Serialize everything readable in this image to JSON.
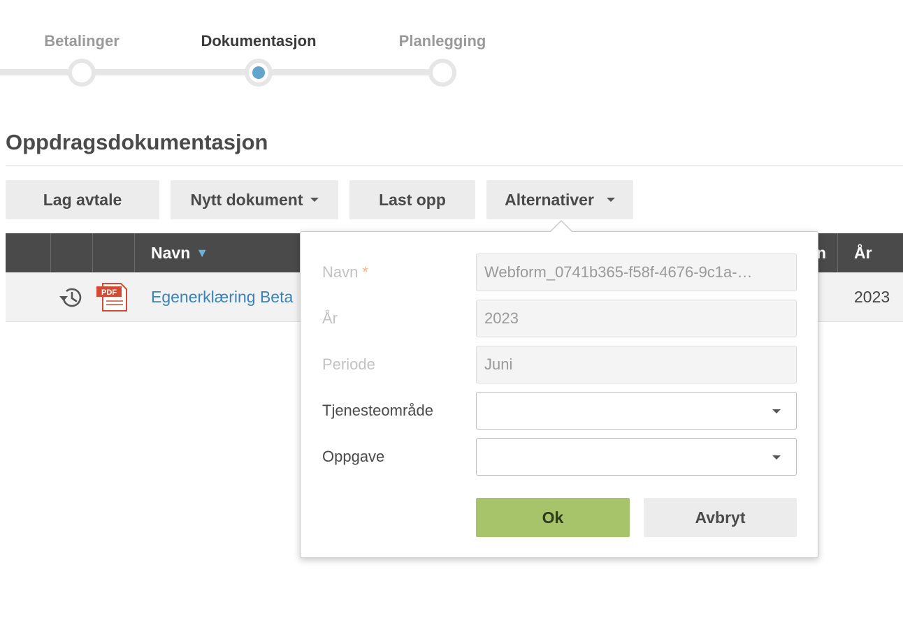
{
  "stepper": {
    "steps": [
      {
        "label": "Betalinger",
        "active": false
      },
      {
        "label": "Dokumentasjon",
        "active": true
      },
      {
        "label": "Planlegging",
        "active": false
      }
    ]
  },
  "page": {
    "title": "Oppdragsdokumentasjon"
  },
  "toolbar": {
    "lag_avtale": "Lag avtale",
    "nytt_dokument": "Nytt dokument",
    "last_opp": "Last opp",
    "alternativer": "Alternativer"
  },
  "table": {
    "columns": {
      "name": "Navn",
      "partial": "n",
      "year": "År"
    },
    "rows": [
      {
        "name": "Egenerklæring Beta",
        "year": "2023",
        "file_type": "PDF"
      }
    ]
  },
  "form": {
    "name_label": "Navn",
    "required_mark": "*",
    "name_value": "Webform_0741b365-f58f-4676-9c1a-…",
    "year_label": "År",
    "year_value": "2023",
    "period_label": "Periode",
    "period_value": "Juni",
    "service_label": "Tjenesteområde",
    "service_value": "",
    "task_label": "Oppgave",
    "task_value": "",
    "ok": "Ok",
    "cancel": "Avbryt"
  },
  "colors": {
    "accent": "#62a5cc",
    "link": "#3b82b8",
    "ok_button": "#a8c46b",
    "header_bg": "#4a4a4a"
  },
  "icons": [
    "history-icon",
    "pdf-icon",
    "sort-desc-icon",
    "chevron-down-icon"
  ]
}
